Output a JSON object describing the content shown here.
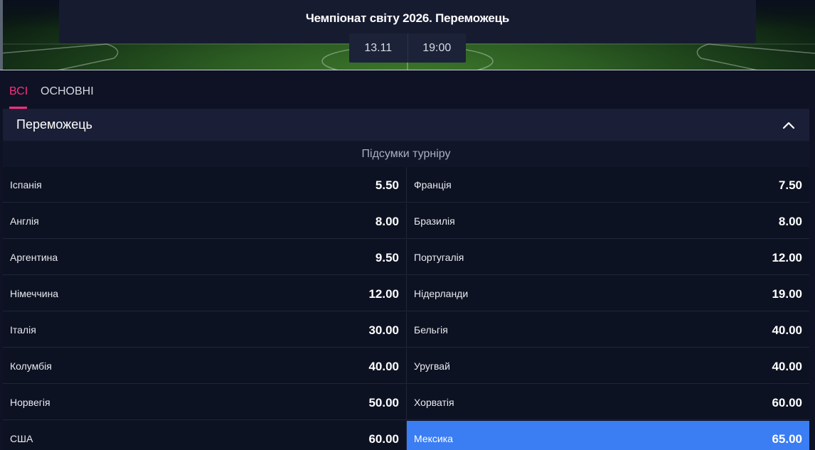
{
  "event": {
    "title": "Чемпіонат світу 2026. Переможець",
    "date": "13.11",
    "time": "19:00"
  },
  "tabs": [
    {
      "label": "ВСІ",
      "active": true
    },
    {
      "label": "ОСНОВНІ",
      "active": false
    }
  ],
  "market": {
    "title": "Переможець",
    "expanded": true,
    "section_title": "Підсумки турніру",
    "rows": [
      [
        {
          "name": "Іспанія",
          "odds": "5.50"
        },
        {
          "name": "Франція",
          "odds": "7.50"
        }
      ],
      [
        {
          "name": "Англія",
          "odds": "8.00"
        },
        {
          "name": "Бразилія",
          "odds": "8.00"
        }
      ],
      [
        {
          "name": "Аргентина",
          "odds": "9.50"
        },
        {
          "name": "Португалія",
          "odds": "12.00"
        }
      ],
      [
        {
          "name": "Німеччина",
          "odds": "12.00"
        },
        {
          "name": "Нідерланди",
          "odds": "19.00"
        }
      ],
      [
        {
          "name": "Італія",
          "odds": "30.00"
        },
        {
          "name": "Бельгія",
          "odds": "40.00"
        }
      ],
      [
        {
          "name": "Колумбія",
          "odds": "40.00"
        },
        {
          "name": "Уругвай",
          "odds": "40.00"
        }
      ],
      [
        {
          "name": "Норвегія",
          "odds": "50.00"
        },
        {
          "name": "Хорватія",
          "odds": "60.00"
        }
      ],
      [
        {
          "name": "США",
          "odds": "60.00"
        },
        {
          "name": "Мексика",
          "odds": "65.00",
          "selected": true
        }
      ]
    ]
  },
  "colors": {
    "accent": "#ff2e7e",
    "selected": "#3b7df2",
    "background": "#0e1224"
  }
}
